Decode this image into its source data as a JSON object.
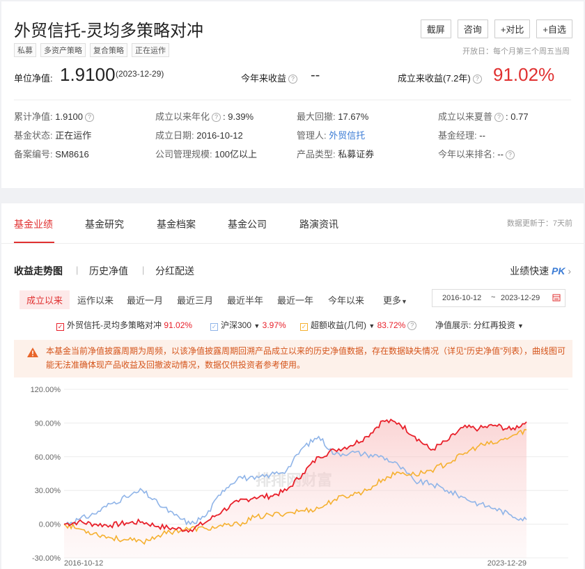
{
  "header": {
    "title": "外贸信托-灵均多策略对冲",
    "tags": [
      "私募",
      "多资产策略",
      "复合策略",
      "正在运作"
    ],
    "buttons": [
      "截屏",
      "咨询",
      "+对比",
      "+自选"
    ],
    "open_day": "开放日：每个月第三个周五当周"
  },
  "nav": {
    "label": "单位净值:",
    "value": "1.9100",
    "date": "(2023-12-29)",
    "ytd_label": "今年来收益",
    "ytd_value": "--",
    "since_label": "成立来收益(7.2年)",
    "since_value": "91.02%"
  },
  "info": [
    {
      "k": "累计净值:",
      "v": "1.9100"
    },
    {
      "k": "成立以来年化",
      "v": "9.39%"
    },
    {
      "k": "最大回撤:",
      "v": "17.67%"
    },
    {
      "k": "成立以来夏普",
      "v": "0.77"
    },
    {
      "k": "基金状态:",
      "v": "正在运作"
    },
    {
      "k": "成立日期:",
      "v": "2016-10-12"
    },
    {
      "k": "管理人:",
      "v": "外贸信托"
    },
    {
      "k": "基金经理:",
      "v": "--"
    },
    {
      "k": "备案编号:",
      "v": "SM8616"
    },
    {
      "k": "公司管理规模:",
      "v": "100亿以上"
    },
    {
      "k": "产品类型:",
      "v": "私募证券"
    },
    {
      "k": "今年以来排名:",
      "v": "--"
    }
  ],
  "tabs": [
    "基金业绩",
    "基金研究",
    "基金档案",
    "基金公司",
    "路演资讯"
  ],
  "update_text": "数据更新于：7天前",
  "subtabs": [
    "收益走势图",
    "历史净值",
    "分红配送"
  ],
  "pk_text": "业绩快速",
  "pk_badge": "PK",
  "ranges": [
    "成立以来",
    "运作以来",
    "最近一月",
    "最近三月",
    "最近半年",
    "最近一年",
    "今年以来",
    "更多"
  ],
  "date_start": "2016-10-12",
  "date_tilde": "~",
  "date_end": "2023-12-29",
  "legend": {
    "fund_name": "外贸信托-灵均多策略对冲",
    "fund_value": "91.02%",
    "bench_name": "沪深300",
    "bench_value": "3.97%",
    "excess_name": "超额收益(几何)",
    "excess_value": "83.72%",
    "nav_display_label": "净值展示:",
    "nav_display_value": "分红再投资"
  },
  "warning": "本基金当前净值披露周期为周频，以该净值披露周期回溯产品成立以来的历史净值数据，存在数据缺失情况（详见“历史净值”列表），曲线图可能无法准确体现产品收益及回撤波动情况，数据仅供投资者参考使用。",
  "watermark": "排排网财富",
  "colors": {
    "fund": "#e8202a",
    "bench": "#8fb4e8",
    "excess": "#f5b02f",
    "accent": "#e03030"
  },
  "chart_data": {
    "type": "line",
    "ylim": [
      -30,
      120
    ],
    "yticks": [
      "120.00%",
      "90.00%",
      "60.00%",
      "30.00%",
      "0.00%",
      "-30.00%"
    ],
    "x_labels": [
      "2016-10-12",
      "2023-12-29"
    ],
    "x": [
      2016.78,
      2017.0,
      2017.25,
      2017.5,
      2017.75,
      2018.0,
      2018.25,
      2018.5,
      2018.75,
      2019.0,
      2019.25,
      2019.5,
      2019.75,
      2020.0,
      2020.25,
      2020.5,
      2020.75,
      2021.0,
      2021.25,
      2021.5,
      2021.75,
      2022.0,
      2022.25,
      2022.5,
      2022.75,
      2023.0,
      2023.25,
      2023.5,
      2023.75,
      2023.99
    ],
    "series": [
      {
        "name": "外贸信托-灵均多策略对冲",
        "color": "#e8202a",
        "values": [
          0,
          2,
          0,
          -1,
          1,
          2,
          -2,
          -4,
          -5,
          2,
          12,
          20,
          24,
          25,
          30,
          45,
          60,
          66,
          70,
          78,
          92,
          90,
          78,
          66,
          74,
          86,
          85,
          88,
          84,
          91
        ]
      },
      {
        "name": "沪深300",
        "color": "#8fb4e8",
        "values": [
          0,
          4,
          9,
          18,
          24,
          30,
          18,
          8,
          0,
          8,
          30,
          42,
          40,
          44,
          48,
          68,
          78,
          62,
          64,
          62,
          60,
          52,
          38,
          36,
          30,
          24,
          18,
          14,
          8,
          4
        ]
      },
      {
        "name": "超额收益(几何)",
        "color": "#f5b02f",
        "values": [
          0,
          -4,
          -8,
          -12,
          -14,
          -16,
          -10,
          -6,
          -4,
          -4,
          -2,
          0,
          6,
          8,
          10,
          12,
          14,
          22,
          26,
          30,
          40,
          46,
          44,
          48,
          54,
          62,
          70,
          72,
          78,
          84
        ]
      }
    ]
  }
}
